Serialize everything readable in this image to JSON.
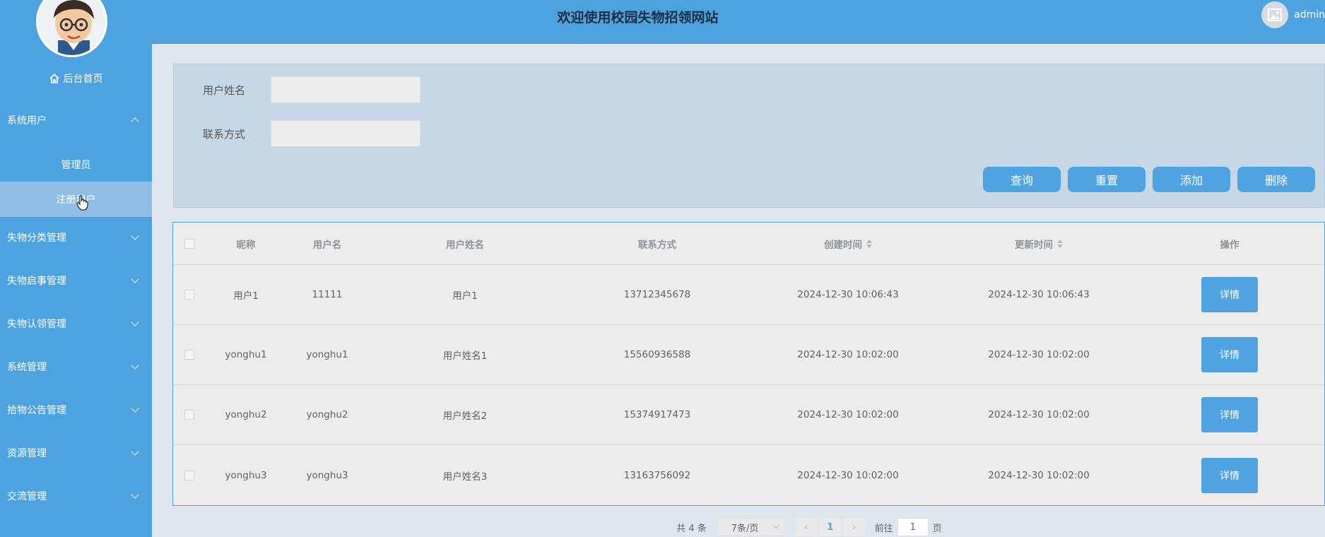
{
  "header": {
    "title": "欢迎使用校园失物招领网站",
    "username": "admin"
  },
  "sidebar": {
    "home_label": "后台首页",
    "system_users": {
      "label": "系统用户",
      "children": [
        "管理员",
        "注册用户"
      ]
    },
    "menus": [
      "失物分类管理",
      "失物启事管理",
      "失物认领管理",
      "系统管理",
      "拾物公告管理",
      "资源管理",
      "交流管理"
    ]
  },
  "search": {
    "name_label": "用户姓名",
    "name_value": "",
    "phone_label": "联系方式",
    "phone_value": "",
    "buttons": {
      "query": "查询",
      "reset": "重置",
      "add": "添加",
      "delete": "删除"
    }
  },
  "table": {
    "headers": {
      "nickname": "昵称",
      "username": "用户名",
      "realname": "用户姓名",
      "phone": "联系方式",
      "created": "创建时间",
      "updated": "更新时间",
      "action": "操作"
    },
    "rows": [
      {
        "nickname": "用户1",
        "username": "11111",
        "realname": "用户1",
        "phone": "13712345678",
        "created": "2024-12-30 10:06:43",
        "updated": "2024-12-30 10:06:43",
        "action": "详情"
      },
      {
        "nickname": "yonghu1",
        "username": "yonghu1",
        "realname": "用户姓名1",
        "phone": "15560936588",
        "created": "2024-12-30 10:02:00",
        "updated": "2024-12-30 10:02:00",
        "action": "详情"
      },
      {
        "nickname": "yonghu2",
        "username": "yonghu2",
        "realname": "用户姓名2",
        "phone": "15374917473",
        "created": "2024-12-30 10:02:00",
        "updated": "2024-12-30 10:02:00",
        "action": "详情"
      },
      {
        "nickname": "yonghu3",
        "username": "yonghu3",
        "realname": "用户姓名3",
        "phone": "13163756092",
        "created": "2024-12-30 10:02:00",
        "updated": "2024-12-30 10:02:00",
        "action": "详情"
      }
    ]
  },
  "pagination": {
    "total": "共 4 条",
    "page_size": "7条/页",
    "current_page": "1",
    "goto_label": "前往",
    "goto_value": "1",
    "page_suffix": "页"
  },
  "colors": {
    "primary": "#4da3df",
    "active_menu": "#8fbde5"
  }
}
